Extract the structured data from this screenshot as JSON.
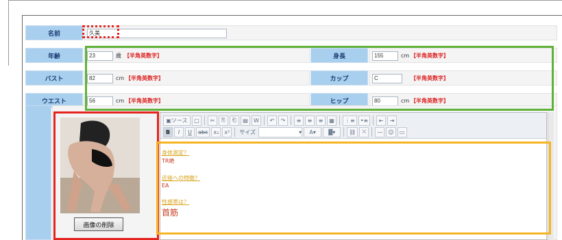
{
  "form": {
    "name": {
      "label": "名前",
      "value": "久美"
    },
    "age": {
      "label": "年齢",
      "value": "23",
      "unit": "歳",
      "hint": "【半角英数字】"
    },
    "height": {
      "label": "身長",
      "value": "155",
      "unit": "cm",
      "hint": "【半角英数字】"
    },
    "bust": {
      "label": "バスト",
      "value": "82",
      "unit": "cm",
      "hint": "【半角英数字】"
    },
    "cup": {
      "label": "カップ",
      "value": "C",
      "hint": "【半角英数字】"
    },
    "waist": {
      "label": "ウエスト",
      "value": "56",
      "unit": "cm",
      "hint": "【半角英数字】"
    },
    "hip": {
      "label": "ヒップ",
      "value": "80",
      "unit": "cm",
      "hint": "【半角英数字】"
    }
  },
  "photo": {
    "delete_button": "画像の削除"
  },
  "editor": {
    "toolbar": {
      "source": "ソース",
      "bold": "B",
      "italic": "I",
      "underline": "U",
      "strike": "abc",
      "subscript": "x₂",
      "superscript": "x²",
      "size_label": "サイズ"
    },
    "content": [
      {
        "question": "身体測定？",
        "answer": "TR絶"
      },
      {
        "question": "近接への特徴？",
        "answer": "EA"
      },
      {
        "question": "性感帯は？",
        "answer": "首筋"
      }
    ]
  },
  "colors": {
    "label_bg": "#a9cfee",
    "highlight_red": "#e3231c",
    "highlight_green": "#5fb13a",
    "highlight_yellow": "#f5b522",
    "hint_red": "#d22"
  }
}
